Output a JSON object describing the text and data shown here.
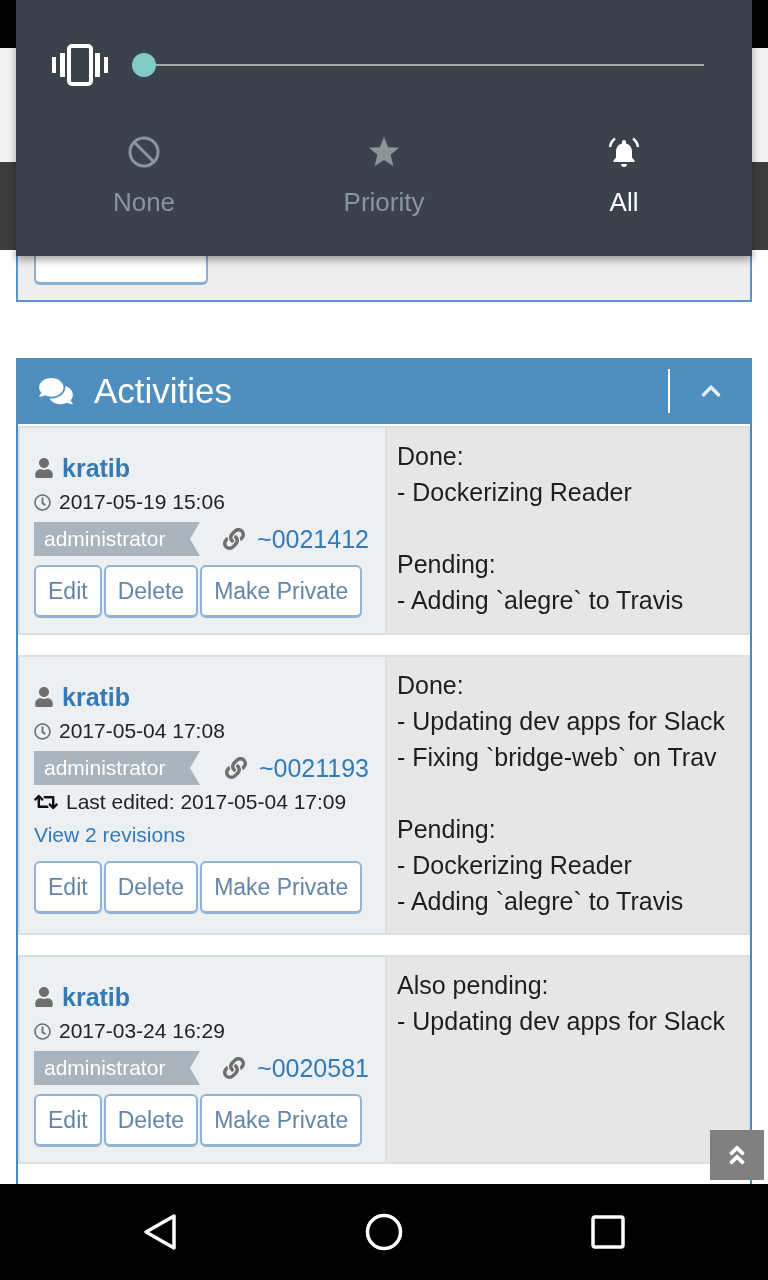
{
  "quick_settings": {
    "slider": {
      "level": 0
    },
    "modes": [
      {
        "label": "None",
        "selected": false
      },
      {
        "label": "Priority",
        "selected": false
      },
      {
        "label": "All",
        "selected": true
      }
    ]
  },
  "activities": {
    "title": "Activities",
    "expanded": true,
    "entries": [
      {
        "author": "kratib",
        "time": "2017-05-19 15:06",
        "role": "administrator",
        "ref": "~0021412",
        "actions": [
          "Edit",
          "Delete",
          "Make Private"
        ],
        "note": [
          [
            "Done:",
            "- Dockerizing Reader"
          ],
          [
            "Pending:",
            "- Adding `alegre` to Travis"
          ]
        ]
      },
      {
        "author": "kratib",
        "time": "2017-05-04 17:08",
        "role": "administrator",
        "ref": "~0021193",
        "edited": "Last edited: 2017-05-04 17:09",
        "revisions": "View 2 revisions",
        "actions": [
          "Edit",
          "Delete",
          "Make Private"
        ],
        "note": [
          [
            "Done:",
            "- Updating dev apps for Slack",
            "- Fixing `bridge-web` on Trav"
          ],
          [
            "Pending:",
            "- Dockerizing Reader",
            "- Adding `alegre` to Travis"
          ]
        ]
      },
      {
        "author": "kratib",
        "time": "2017-03-24 16:29",
        "role": "administrator",
        "ref": "~0020581",
        "actions": [
          "Edit",
          "Delete",
          "Make Private"
        ],
        "note": [
          [
            "Also pending:",
            "- Updating dev apps for Slack"
          ]
        ]
      }
    ]
  }
}
